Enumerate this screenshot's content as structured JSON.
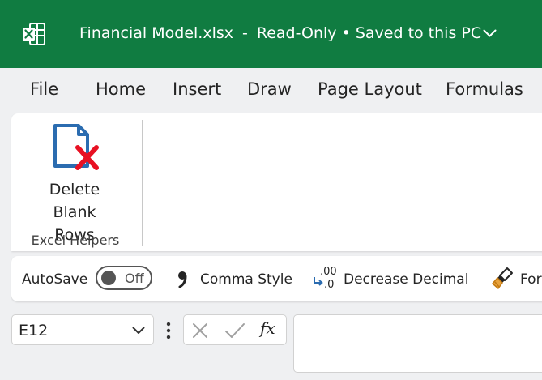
{
  "titlebar": {
    "filename": "Financial Model.xlsx",
    "separator": "-",
    "mode": "Read-Only",
    "bullet": "•",
    "save_status": "Saved to this PC",
    "icons": {
      "app": "excel-logo-icon",
      "status_menu": "chevron-down-icon"
    },
    "colors": {
      "background": "#107c41",
      "text": "#ffffff"
    }
  },
  "menu": {
    "items": [
      {
        "label": "File"
      },
      {
        "label": "Home"
      },
      {
        "label": "Insert"
      },
      {
        "label": "Draw"
      },
      {
        "label": "Page Layout"
      },
      {
        "label": "Formulas"
      }
    ]
  },
  "ribbon": {
    "delete_button": {
      "line1": "Delete",
      "line2": "Blank Rows",
      "icon": "delete-file-icon"
    },
    "group_label": "Excel Helpers",
    "colors": {
      "icon_blue": "#2b6cb0",
      "icon_red": "#e81123"
    }
  },
  "qat": {
    "autosave_label": "AutoSave",
    "autosave_state": "Off",
    "comma_style": {
      "label": "Comma Style",
      "icon": "comma-icon"
    },
    "decrease_decimal": {
      "label": "Decrease Decimal",
      "icon": "decrease-decimal-icon",
      "glyph_top": ".00",
      "glyph_bottom": ".0"
    },
    "format_painter": {
      "label": "For",
      "icon": "paintbrush-icon"
    }
  },
  "formula_bar": {
    "name_box_value": "E12",
    "fx_label": "fx",
    "formula_value": "",
    "icons": {
      "name_box": "chevron-down-icon",
      "more": "more-vertical-icon",
      "cancel": "close-icon",
      "enter": "check-icon"
    }
  }
}
